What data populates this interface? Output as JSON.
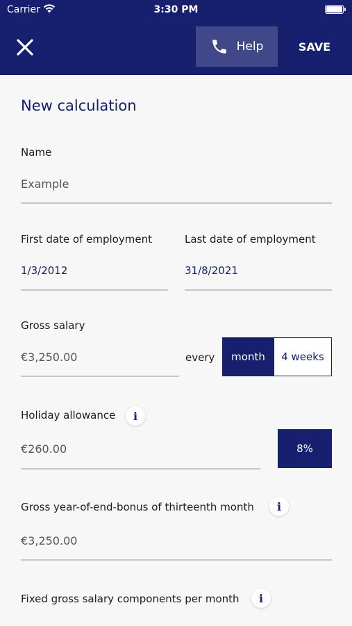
{
  "status_bar": {
    "carrier": "Carrier",
    "time": "3:30 PM"
  },
  "nav": {
    "help_label": "Help",
    "save_label": "SAVE"
  },
  "page_title": "New calculation",
  "form": {
    "name": {
      "label": "Name",
      "value": "Example"
    },
    "first_date": {
      "label": "First date of employment",
      "value": "1/3/2012"
    },
    "last_date": {
      "label": "Last date of employment",
      "value": "31/8/2021"
    },
    "gross_salary": {
      "label": "Gross salary",
      "value": "€3,250.00",
      "every_label": "every",
      "options": [
        "month",
        "4 weeks"
      ],
      "selected": "month"
    },
    "holiday_allowance": {
      "label": "Holiday allowance",
      "value": "€260.00",
      "percent": "8%"
    },
    "bonus": {
      "label": "Gross year-of-end-bonus of thirteenth month",
      "value": "€3,250.00"
    },
    "fixed_components": {
      "label": "Fixed gross salary components per month"
    }
  },
  "icons": {
    "info": "i"
  },
  "colors": {
    "primary": "#16206f",
    "background": "#f7f7f8"
  }
}
